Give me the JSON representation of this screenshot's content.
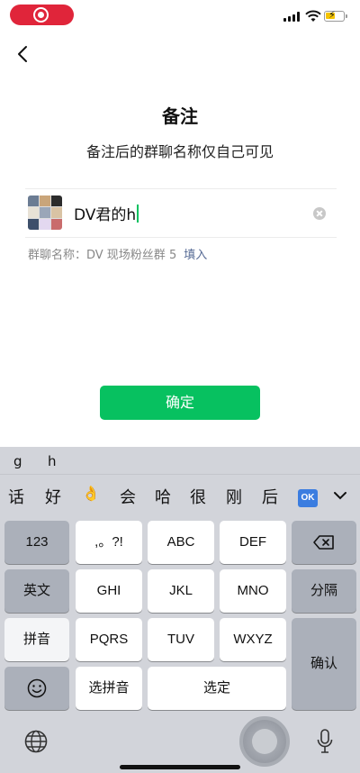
{
  "status_bar": {
    "recording_indicator": "screen-recording",
    "icons": [
      "signal-icon",
      "wifi-icon",
      "battery-charging-icon"
    ]
  },
  "page": {
    "title": "备注",
    "subtitle": "备注后的群聊名称仅自己可见"
  },
  "remark_input": {
    "value": "DV君的h"
  },
  "group_hint": {
    "label": "群聊名称：DV 现场粉丝群 5",
    "fill_link": "填入"
  },
  "confirm_button": {
    "label": "确定",
    "color": "#07c160"
  },
  "keyboard": {
    "pinyin": [
      "g",
      "h"
    ],
    "candidates": [
      "话",
      "好",
      "👌",
      "会",
      "哈",
      "很",
      "刚",
      "后"
    ],
    "ok_badge": "OK",
    "keys": {
      "num": "123",
      "punct": ",。?!",
      "abc": "ABC",
      "def": "DEF",
      "english": "英文",
      "ghi": "GHI",
      "jkl": "JKL",
      "mno": "MNO",
      "separate": "分隔",
      "pinyin": "拼音",
      "pqrs": "PQRS",
      "tuv": "TUV",
      "wxyz": "WXYZ",
      "confirm": "确认",
      "select_pinyin": "选拼音",
      "select": "选定"
    }
  }
}
